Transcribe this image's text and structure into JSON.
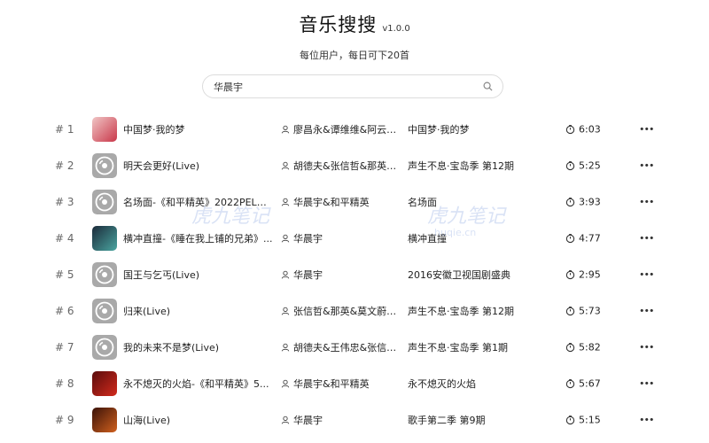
{
  "app": {
    "title": "音乐搜搜",
    "version": "v1.0.0",
    "subtitle": "每位用户，每日可下20首"
  },
  "search": {
    "value": "华晨宇",
    "icon": "search-icon"
  },
  "watermarks": [
    "虎九笔记",
    "虎九笔记",
    "huqie.cn"
  ],
  "songs": [
    {
      "index": "# 1",
      "title": "中国梦·我的梦",
      "artist": "廖昌永&谭维维&阿云嘎...",
      "album": "中国梦·我的梦",
      "duration": "6:03",
      "cover": "photo",
      "cover_colors": [
        "#f0c5c5",
        "#c9384a"
      ]
    },
    {
      "index": "# 2",
      "title": "明天会更好(Live)",
      "artist": "胡德夫&张信哲&那英&...",
      "album": "声生不息·宝岛季 第12期",
      "duration": "5:25",
      "cover": "disc"
    },
    {
      "index": "# 3",
      "title": "名场面-《和平精英》2022PEL年...",
      "artist": "华晨宇&和平精英",
      "album": "名场面",
      "duration": "3:93",
      "cover": "disc"
    },
    {
      "index": "# 4",
      "title": "横冲直撞-《睡在我上铺的兄弟》...",
      "artist": "华晨宇",
      "album": "横冲直撞",
      "duration": "4:77",
      "cover": "photo",
      "cover_colors": [
        "#1b2a3a",
        "#4aa5a0"
      ]
    },
    {
      "index": "# 5",
      "title": "国王与乞丐(Live)",
      "artist": "华晨宇",
      "album": "2016安徽卫视国剧盛典",
      "duration": "2:95",
      "cover": "disc"
    },
    {
      "index": "# 6",
      "title": "归来(Live)",
      "artist": "张信哲&那英&莫文蔚&...",
      "album": "声生不息·宝岛季 第12期",
      "duration": "5:73",
      "cover": "disc"
    },
    {
      "index": "# 7",
      "title": "我的未来不是梦(Live)",
      "artist": "胡德夫&王伟忠&张信哲...",
      "album": "声生不息·宝岛季 第1期",
      "duration": "5:82",
      "cover": "disc"
    },
    {
      "index": "# 8",
      "title": "永不熄灭的火焰-《和平精英》5...",
      "artist": "华晨宇&和平精英",
      "album": "永不熄灭的火焰",
      "duration": "5:67",
      "cover": "photo",
      "cover_colors": [
        "#5a0c0c",
        "#d22a1c"
      ]
    },
    {
      "index": "# 9",
      "title": "山海(Live)",
      "artist": "华晨宇",
      "album": "歌手第二季 第9期",
      "duration": "5:15",
      "cover": "photo",
      "cover_colors": [
        "#3a1208",
        "#d0601e"
      ]
    }
  ]
}
